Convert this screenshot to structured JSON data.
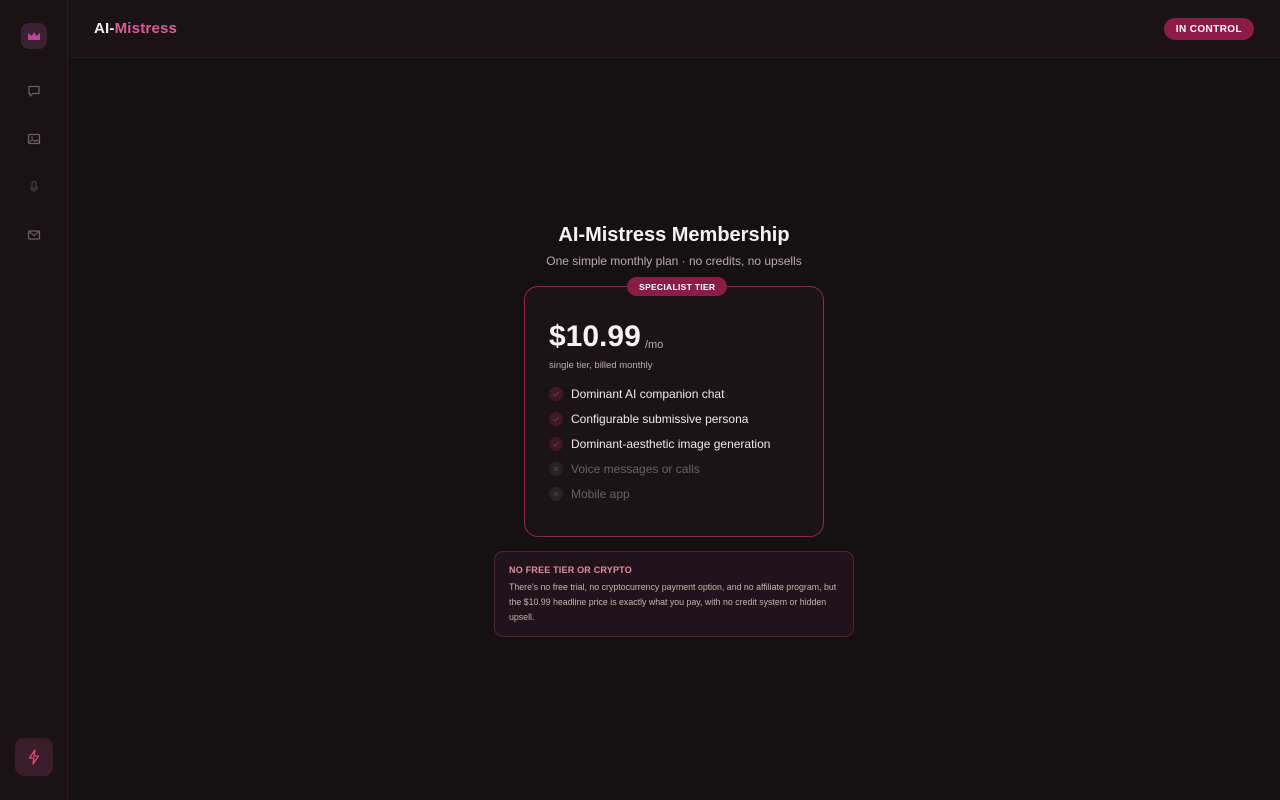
{
  "brand": {
    "part1": "AI-",
    "part2": "Mistress"
  },
  "header": {
    "status": "IN CONTROL"
  },
  "sidebar": {
    "logo_icon": "crown-icon",
    "nav": [
      {
        "id": "chat",
        "icon": "chat-bubble-icon"
      },
      {
        "id": "images",
        "icon": "image-icon"
      },
      {
        "id": "voice",
        "icon": "microphone-icon"
      },
      {
        "id": "messages",
        "icon": "envelope-icon"
      }
    ],
    "action_icon": "lightning-icon"
  },
  "membership": {
    "title": "AI-Mistress Membership",
    "subtitle": "One simple monthly plan · no credits, no upsells",
    "badge": "SPECIALIST TIER",
    "price": "$10.99",
    "price_unit": "/mo",
    "billing_note": "single tier, billed monthly",
    "features": [
      {
        "label": "Dominant AI companion chat",
        "included": true
      },
      {
        "label": "Configurable submissive persona",
        "included": true
      },
      {
        "label": "Dominant-aesthetic image generation",
        "included": true
      },
      {
        "label": "Voice messages or calls",
        "included": false
      },
      {
        "label": "Mobile app",
        "included": false
      }
    ]
  },
  "notice": {
    "title": "NO FREE TIER OR CRYPTO",
    "body": "There's no free trial, no cryptocurrency payment option, and no affiliate program, but the $10.99 headline price is exactly what you pay, with no credit system or hidden upsell."
  },
  "colors": {
    "accent": "#8a1c45",
    "brand_pink": "#d75c9d",
    "background": "#151012"
  }
}
